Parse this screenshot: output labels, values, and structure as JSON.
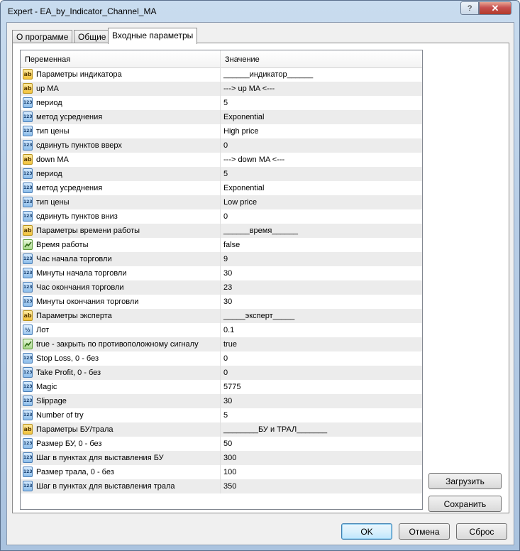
{
  "window": {
    "title": "Expert - EA_by_Indicator_Channel_MA",
    "help_label": "?",
    "close_label": "✕"
  },
  "tabs": [
    {
      "label": "О программе"
    },
    {
      "label": "Общие"
    },
    {
      "label": "Входные параметры"
    }
  ],
  "grid": {
    "col_variable": "Переменная",
    "col_value": "Значение",
    "rows": [
      {
        "icon": "ab",
        "name": "Параметры индикатора",
        "value": "______индикатор______"
      },
      {
        "icon": "ab",
        "name": "up MA",
        "value": "---> up  MA <---"
      },
      {
        "icon": "123",
        "name": "период",
        "value": "5"
      },
      {
        "icon": "123",
        "name": "метод усреднения",
        "value": "Exponential"
      },
      {
        "icon": "123",
        "name": "тип цены",
        "value": "High price"
      },
      {
        "icon": "123",
        "name": "сдвинуть пунктов вверх",
        "value": "0"
      },
      {
        "icon": "ab",
        "name": "down MA",
        "value": "---> down  MA <---"
      },
      {
        "icon": "123",
        "name": "период",
        "value": "5"
      },
      {
        "icon": "123",
        "name": "метод усреднения",
        "value": "Exponential"
      },
      {
        "icon": "123",
        "name": "тип цены",
        "value": "Low price"
      },
      {
        "icon": "123",
        "name": "сдвинуть пунктов вниз",
        "value": "0"
      },
      {
        "icon": "ab",
        "name": "Параметры времени работы",
        "value": "______время______"
      },
      {
        "icon": "bool",
        "name": "Время работы",
        "value": "false"
      },
      {
        "icon": "123",
        "name": "Час начала торговли",
        "value": "9"
      },
      {
        "icon": "123",
        "name": "Минуты начала торговли",
        "value": "30"
      },
      {
        "icon": "123",
        "name": "Час окончания торговли",
        "value": "23"
      },
      {
        "icon": "123",
        "name": "Минуты окончания торговли",
        "value": "30"
      },
      {
        "icon": "ab",
        "name": "Параметры эксперта",
        "value": "_____эксперт_____"
      },
      {
        "icon": "half",
        "name": "Лот",
        "value": "0.1"
      },
      {
        "icon": "bool",
        "name": "true - закрыть по противоположному сигналу",
        "value": "true"
      },
      {
        "icon": "123",
        "name": "Stop Loss, 0 - без",
        "value": "0"
      },
      {
        "icon": "123",
        "name": "Take Profit, 0 - без",
        "value": "0"
      },
      {
        "icon": "123",
        "name": "Magic",
        "value": "5775"
      },
      {
        "icon": "123",
        "name": "Slippage",
        "value": "30"
      },
      {
        "icon": "123",
        "name": "Number of try",
        "value": "5"
      },
      {
        "icon": "ab",
        "name": "Параметры БУ/трала",
        "value": "________БУ и ТРАЛ_______"
      },
      {
        "icon": "123",
        "name": "Размер БУ, 0 - без",
        "value": "50"
      },
      {
        "icon": "123",
        "name": "Шаг в пунктах для выставления БУ",
        "value": "300"
      },
      {
        "icon": "123",
        "name": "Размер трала, 0 - без",
        "value": "100"
      },
      {
        "icon": "123",
        "name": "Шаг в пунктах для выставления трала",
        "value": "350"
      }
    ]
  },
  "side_buttons": {
    "load": "Загрузить",
    "save": "Сохранить"
  },
  "footer_buttons": {
    "ok": "OK",
    "cancel": "Отмена",
    "reset": "Сброс"
  }
}
